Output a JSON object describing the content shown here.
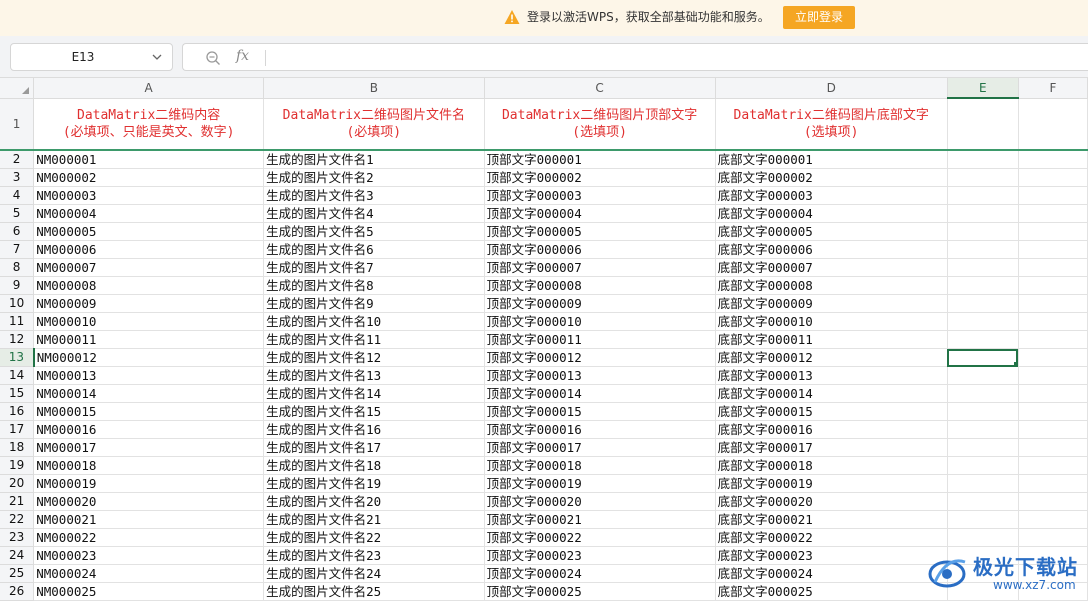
{
  "notice": {
    "message": "登录以激活WPS，获取全部基础功能和服务。",
    "login_button": "立即登录"
  },
  "formula_bar": {
    "name_box": "E13",
    "fx_label": "fx",
    "formula_value": ""
  },
  "columns": [
    "A",
    "B",
    "C",
    "D",
    "E",
    "F"
  ],
  "selected_column": "E",
  "selected_row": 13,
  "header_row": {
    "row_number": "1",
    "A_line1": "DataMatrix二维码内容",
    "A_line2": "(必填项、只能是英文、数字)",
    "B_line1": "DataMatrix二维码图片文件名",
    "B_line2": "(必填项)",
    "C_line1": "DataMatrix二维码图片顶部文字",
    "C_line2": "(选填项)",
    "D_line1": "DataMatrix二维码图片底部文字",
    "D_line2": "(选填项)"
  },
  "rows": [
    {
      "n": "2",
      "a": "NM000001",
      "b": "生成的图片文件名1",
      "c": "顶部文字000001",
      "d": "底部文字000001"
    },
    {
      "n": "3",
      "a": "NM000002",
      "b": "生成的图片文件名2",
      "c": "顶部文字000002",
      "d": "底部文字000002"
    },
    {
      "n": "4",
      "a": "NM000003",
      "b": "生成的图片文件名3",
      "c": "顶部文字000003",
      "d": "底部文字000003"
    },
    {
      "n": "5",
      "a": "NM000004",
      "b": "生成的图片文件名4",
      "c": "顶部文字000004",
      "d": "底部文字000004"
    },
    {
      "n": "6",
      "a": "NM000005",
      "b": "生成的图片文件名5",
      "c": "顶部文字000005",
      "d": "底部文字000005"
    },
    {
      "n": "7",
      "a": "NM000006",
      "b": "生成的图片文件名6",
      "c": "顶部文字000006",
      "d": "底部文字000006"
    },
    {
      "n": "8",
      "a": "NM000007",
      "b": "生成的图片文件名7",
      "c": "顶部文字000007",
      "d": "底部文字000007"
    },
    {
      "n": "9",
      "a": "NM000008",
      "b": "生成的图片文件名8",
      "c": "顶部文字000008",
      "d": "底部文字000008"
    },
    {
      "n": "10",
      "a": "NM000009",
      "b": "生成的图片文件名9",
      "c": "顶部文字000009",
      "d": "底部文字000009"
    },
    {
      "n": "11",
      "a": "NM000010",
      "b": "生成的图片文件名10",
      "c": "顶部文字000010",
      "d": "底部文字000010"
    },
    {
      "n": "12",
      "a": "NM000011",
      "b": "生成的图片文件名11",
      "c": "顶部文字000011",
      "d": "底部文字000011"
    },
    {
      "n": "13",
      "a": "NM000012",
      "b": "生成的图片文件名12",
      "c": "顶部文字000012",
      "d": "底部文字000012"
    },
    {
      "n": "14",
      "a": "NM000013",
      "b": "生成的图片文件名13",
      "c": "顶部文字000013",
      "d": "底部文字000013"
    },
    {
      "n": "15",
      "a": "NM000014",
      "b": "生成的图片文件名14",
      "c": "顶部文字000014",
      "d": "底部文字000014"
    },
    {
      "n": "16",
      "a": "NM000015",
      "b": "生成的图片文件名15",
      "c": "顶部文字000015",
      "d": "底部文字000015"
    },
    {
      "n": "17",
      "a": "NM000016",
      "b": "生成的图片文件名16",
      "c": "顶部文字000016",
      "d": "底部文字000016"
    },
    {
      "n": "18",
      "a": "NM000017",
      "b": "生成的图片文件名17",
      "c": "顶部文字000017",
      "d": "底部文字000017"
    },
    {
      "n": "19",
      "a": "NM000018",
      "b": "生成的图片文件名18",
      "c": "顶部文字000018",
      "d": "底部文字000018"
    },
    {
      "n": "20",
      "a": "NM000019",
      "b": "生成的图片文件名19",
      "c": "顶部文字000019",
      "d": "底部文字000019"
    },
    {
      "n": "21",
      "a": "NM000020",
      "b": "生成的图片文件名20",
      "c": "顶部文字000020",
      "d": "底部文字000020"
    },
    {
      "n": "22",
      "a": "NM000021",
      "b": "生成的图片文件名21",
      "c": "顶部文字000021",
      "d": "底部文字000021"
    },
    {
      "n": "23",
      "a": "NM000022",
      "b": "生成的图片文件名22",
      "c": "顶部文字000022",
      "d": "底部文字000022"
    },
    {
      "n": "24",
      "a": "NM000023",
      "b": "生成的图片文件名23",
      "c": "顶部文字000023",
      "d": "底部文字000023"
    },
    {
      "n": "25",
      "a": "NM000024",
      "b": "生成的图片文件名24",
      "c": "顶部文字000024",
      "d": "底部文字000024"
    },
    {
      "n": "26",
      "a": "NM000025",
      "b": "生成的图片文件名25",
      "c": "顶部文字000025",
      "d": "底部文字000025"
    }
  ],
  "watermark": {
    "brand": "极光下载站",
    "url": "www.xz7.com"
  },
  "colors": {
    "notice_bg": "#fdf6e8",
    "login_button_bg": "#f5a623",
    "header_text": "#e03030",
    "selection": "#217346",
    "watermark": "#2a6dc4"
  }
}
